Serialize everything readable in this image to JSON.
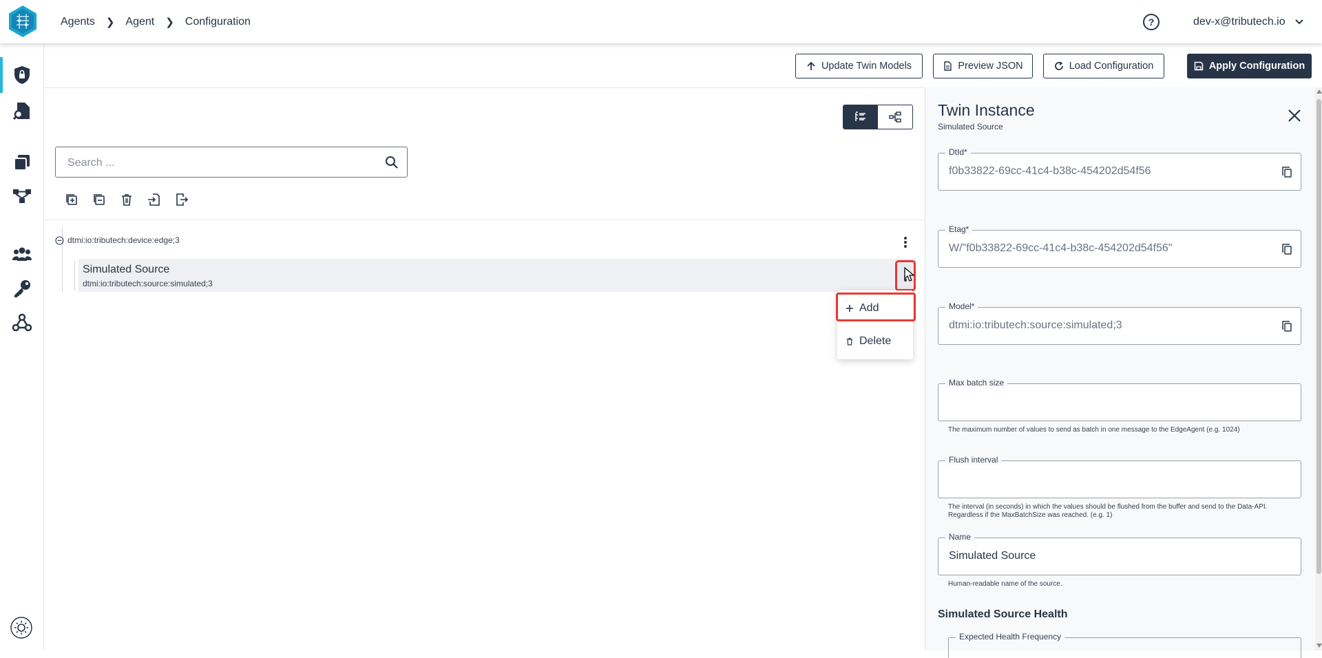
{
  "colors": {
    "primary": "#283447",
    "accent": "#29b6d8",
    "highlight": "#e53935"
  },
  "breadcrumb": [
    "Agents",
    "Agent",
    "Configuration"
  ],
  "user": {
    "email": "dev-x@tributech.io"
  },
  "toolbar": {
    "update_twin_models": "Update Twin Models",
    "preview_json": "Preview JSON",
    "load_configuration": "Load Configuration",
    "apply_configuration": "Apply Configuration"
  },
  "sidebar_icons": [
    "shield-lock-icon",
    "file-search-icon",
    "stack-icon",
    "workflow-icon",
    "users-icon",
    "key-icon",
    "webhook-icon"
  ],
  "search": {
    "placeholder": "Search ..."
  },
  "tree": {
    "root": "dtmi:io:tributech:device:edge;3",
    "child": {
      "title": "Simulated Source",
      "subtitle": "dtmi:io:tributech:source:simulated;3"
    }
  },
  "context_menu": {
    "add": "Add",
    "delete": "Delete"
  },
  "panel": {
    "title": "Twin Instance",
    "subtitle": "Simulated Source",
    "fields": {
      "dtid": {
        "label": "DtId*",
        "value": "f0b33822-69cc-41c4-b38c-454202d54f56"
      },
      "etag": {
        "label": "Etag*",
        "value": "W/\"f0b33822-69cc-41c4-b38c-454202d54f56\""
      },
      "model": {
        "label": "Model*",
        "value": "dtmi:io:tributech:source:simulated;3"
      },
      "max_batch": {
        "label": "Max batch size",
        "value": "",
        "helper": "The maximum number of values to send as batch in one message to the EdgeAgent (e.g. 1024)"
      },
      "flush": {
        "label": "Flush interval",
        "value": "",
        "helper": "The interval (in seconds) in which the values should be flushed from the buffer and send to the Data-API. Regardless if the MaxBatchSize was reached. (e.g. 1)"
      },
      "name": {
        "label": "Name",
        "value": "Simulated Source",
        "helper": "Human-readable name of the source."
      }
    },
    "health_section": "Simulated Source Health",
    "expected_health_label": "Expected Health Frequency"
  }
}
